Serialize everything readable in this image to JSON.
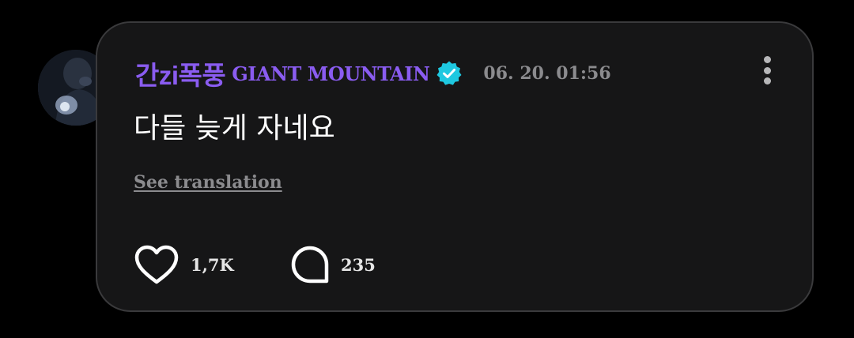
{
  "post": {
    "author": {
      "display_name": "간zi폭풍",
      "group_name": "GIANT MOUNTAIN",
      "avatar_icon": "avatar-photo",
      "verified_icon": "verified-badge-icon"
    },
    "timestamp": "06. 20. 01:56",
    "message": "다들 늦게 자네요",
    "translate_label": "See translation",
    "likes": "1,7K",
    "comments": "235",
    "more_icon": "more-vertical-icon",
    "like_icon": "heart-icon",
    "comment_icon": "comment-bubble-icon"
  },
  "colors": {
    "background": "#000000",
    "card": "#161617",
    "card_border": "#3a3a3c",
    "accent_name": "#8a5cf0",
    "verified": "#1ec8e0",
    "muted_text": "#8b8b8e",
    "text": "#ffffff"
  }
}
